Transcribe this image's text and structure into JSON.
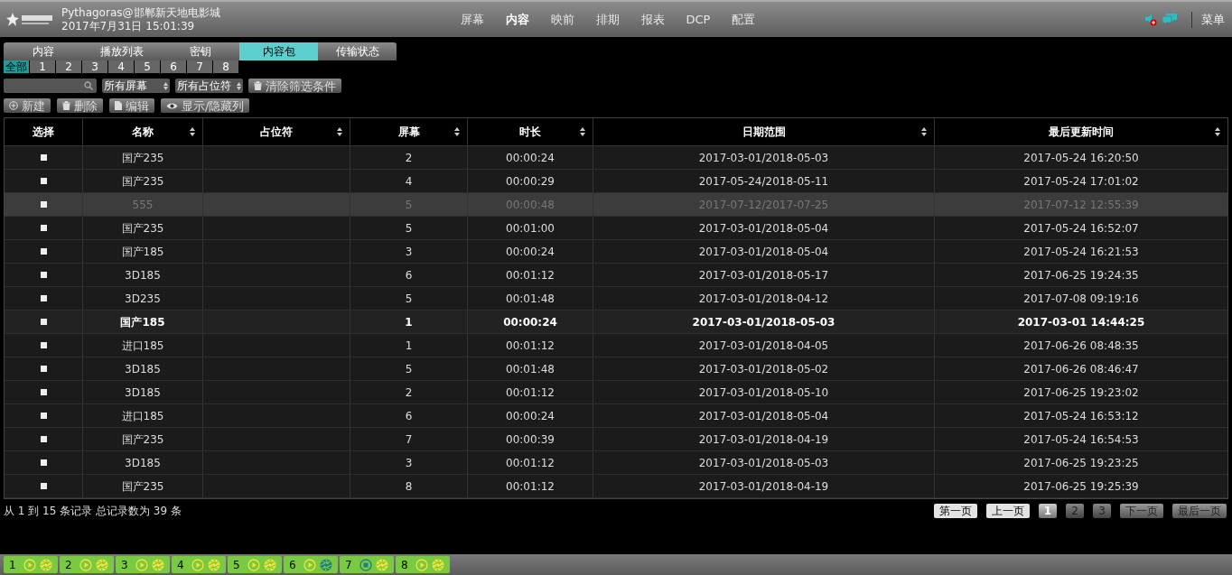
{
  "header": {
    "site": "Pythagoras@邯郸新天地电影城",
    "datetime": "2017年7月31日 15:01:39",
    "nav": [
      {
        "label": "屏幕",
        "selected": false
      },
      {
        "label": "内容",
        "selected": true
      },
      {
        "label": "映前",
        "selected": false
      },
      {
        "label": "排期",
        "selected": false
      },
      {
        "label": "报表",
        "selected": false
      },
      {
        "label": "DCP",
        "selected": false
      },
      {
        "label": "配置",
        "selected": false
      }
    ],
    "menu": "菜单"
  },
  "tabs": [
    {
      "label": "内容",
      "selected": false
    },
    {
      "label": "播放列表",
      "selected": false
    },
    {
      "label": "密钥",
      "selected": false
    },
    {
      "label": "内容包",
      "selected": true
    },
    {
      "label": "传输状态",
      "selected": false
    }
  ],
  "screen_tabs": [
    {
      "label": "全部",
      "selected": true
    },
    {
      "label": "1",
      "selected": false
    },
    {
      "label": "2",
      "selected": false
    },
    {
      "label": "3",
      "selected": false
    },
    {
      "label": "4",
      "selected": false
    },
    {
      "label": "5",
      "selected": false
    },
    {
      "label": "6",
      "selected": false
    },
    {
      "label": "7",
      "selected": false
    },
    {
      "label": "8",
      "selected": false
    }
  ],
  "filters": {
    "screen_select": "所有屏幕",
    "placeholder_select": "所有占位符",
    "clear": "清除筛选条件"
  },
  "actions": [
    {
      "kind": "add",
      "label": "新建"
    },
    {
      "kind": "delete",
      "label": "删除"
    },
    {
      "kind": "edit",
      "label": "编辑"
    },
    {
      "kind": "view",
      "label": "显示/隐藏列"
    }
  ],
  "table": {
    "columns": [
      {
        "label": "选择",
        "sortable": false
      },
      {
        "label": "名称",
        "sortable": true
      },
      {
        "label": "占位符",
        "sortable": true
      },
      {
        "label": "屏幕",
        "sortable": true
      },
      {
        "label": "时长",
        "sortable": true
      },
      {
        "label": "日期范围",
        "sortable": true
      },
      {
        "label": "最后更新时间",
        "sortable": true
      }
    ],
    "rows": [
      {
        "kind": "normal",
        "name": "国产235",
        "screen": "2",
        "duration": "00:00:24",
        "range": "2017-03-01/2018-05-03",
        "updated": "2017-05-24 16:20:50"
      },
      {
        "kind": "normal",
        "name": "国产235",
        "screen": "4",
        "duration": "00:00:29",
        "range": "2017-05-24/2018-05-11",
        "updated": "2017-05-24 17:01:02"
      },
      {
        "kind": "dimmed",
        "name": "555",
        "screen": "5",
        "duration": "00:00:48",
        "range": "2017-07-12/2017-07-25",
        "updated": "2017-07-12 12:55:39"
      },
      {
        "kind": "normal",
        "name": "国产235",
        "screen": "5",
        "duration": "00:01:00",
        "range": "2017-03-01/2018-05-04",
        "updated": "2017-05-24 16:52:07"
      },
      {
        "kind": "normal",
        "name": "国产185",
        "screen": "3",
        "duration": "00:00:24",
        "range": "2017-03-01/2018-05-04",
        "updated": "2017-05-24 16:21:53"
      },
      {
        "kind": "normal",
        "name": "3D185",
        "screen": "6",
        "duration": "00:01:12",
        "range": "2017-03-01/2018-05-17",
        "updated": "2017-06-25 19:24:35"
      },
      {
        "kind": "normal",
        "name": "3D235",
        "screen": "5",
        "duration": "00:01:48",
        "range": "2017-03-01/2018-04-12",
        "updated": "2017-07-08 09:19:16"
      },
      {
        "kind": "bold",
        "name": "国产185",
        "screen": "1",
        "duration": "00:00:24",
        "range": "2017-03-01/2018-05-03",
        "updated": "2017-03-01 14:44:25"
      },
      {
        "kind": "normal",
        "name": "进口185",
        "screen": "1",
        "duration": "00:01:12",
        "range": "2017-03-01/2018-04-05",
        "updated": "2017-06-26 08:48:35"
      },
      {
        "kind": "normal",
        "name": "3D185",
        "screen": "5",
        "duration": "00:01:48",
        "range": "2017-03-01/2018-05-02",
        "updated": "2017-06-26 08:46:47"
      },
      {
        "kind": "normal",
        "name": "3D185",
        "screen": "2",
        "duration": "00:01:12",
        "range": "2017-03-01/2018-05-10",
        "updated": "2017-06-25 19:23:02"
      },
      {
        "kind": "normal",
        "name": "进口185",
        "screen": "6",
        "duration": "00:00:24",
        "range": "2017-03-01/2018-05-04",
        "updated": "2017-05-24 16:53:12"
      },
      {
        "kind": "normal",
        "name": "国产235",
        "screen": "7",
        "duration": "00:00:39",
        "range": "2017-03-01/2018-04-19",
        "updated": "2017-05-24 16:54:53"
      },
      {
        "kind": "normal",
        "name": "3D185",
        "screen": "3",
        "duration": "00:01:12",
        "range": "2017-03-01/2018-05-03",
        "updated": "2017-06-25 19:23:25"
      },
      {
        "kind": "normal",
        "name": "国产235",
        "screen": "8",
        "duration": "00:01:12",
        "range": "2017-03-01/2018-04-19",
        "updated": "2017-06-25 19:25:39"
      }
    ]
  },
  "record_info": "从 1 到 15 条记录 总记录数为 39 条",
  "pagination": [
    {
      "label": "第一页",
      "kind": "nav",
      "disabled": true
    },
    {
      "label": "上一页",
      "kind": "nav",
      "disabled": true
    },
    {
      "label": "1",
      "kind": "page",
      "selected": true
    },
    {
      "label": "2",
      "kind": "page",
      "selected": false
    },
    {
      "label": "3",
      "kind": "page",
      "selected": false
    },
    {
      "label": "下一页",
      "kind": "nav",
      "disabled": false
    },
    {
      "label": "最后一页",
      "kind": "nav",
      "disabled": false
    }
  ],
  "screens": [
    {
      "label": "1",
      "kind": "play",
      "color": "#f2e33a"
    },
    {
      "label": "2",
      "kind": "play",
      "color": "#f2e33a"
    },
    {
      "label": "3",
      "kind": "play",
      "color": "#f2e33a"
    },
    {
      "label": "4",
      "kind": "play",
      "color": "#f2e33a"
    },
    {
      "label": "5",
      "kind": "play",
      "color": "#f2e33a"
    },
    {
      "label": "6",
      "kind": "play",
      "color": "#1f7f86"
    },
    {
      "label": "7",
      "kind": "stop",
      "color": "#f2e33a"
    },
    {
      "label": "8",
      "kind": "play",
      "color": "#f2e33a"
    }
  ]
}
